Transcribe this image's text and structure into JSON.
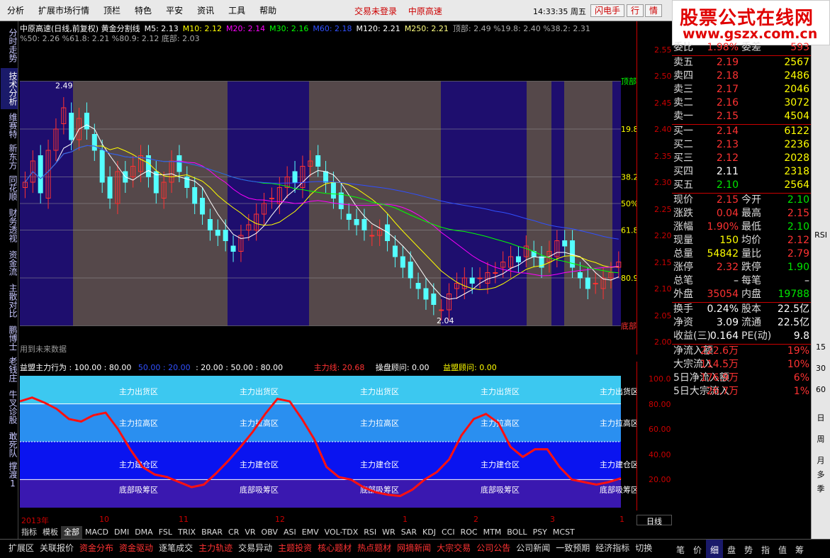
{
  "menu": {
    "items": [
      "分析",
      "扩展市场行情",
      "顶栏",
      "特色",
      "平安",
      "资讯",
      "工具",
      "帮助"
    ],
    "status1": "交易未登录",
    "status2": "中原高速",
    "time": "14:33:35 周五",
    "btn_flash": "闪电手",
    "btn_row": "行",
    "btn_quote": "情"
  },
  "logo": {
    "line1": "股票公式在线网",
    "line2": "www.gszx.com.cn"
  },
  "left_tabs": [
    "分时走势",
    "技术分析",
    "维赛特",
    "新东方",
    "同花顺",
    "财务透视",
    "资金流",
    "主散对比",
    "鹏博士",
    "老钱庄",
    "牛叉诊股",
    "敢死队",
    "撑渡1"
  ],
  "chart_header": {
    "line1": [
      {
        "t": "中原高速(日线,前复权) 黄金分割线",
        "c": "#ffffff"
      },
      {
        "t": "M5: 2.13",
        "c": "#ffffff"
      },
      {
        "t": "M10: 2.12",
        "c": "#ffff00"
      },
      {
        "t": "M20: 2.14",
        "c": "#ff00ff"
      },
      {
        "t": "M30: 2.16",
        "c": "#00ff00"
      },
      {
        "t": "M60: 2.18",
        "c": "#3050ff"
      },
      {
        "t": "M120: 2.21",
        "c": "#ffffff"
      },
      {
        "t": "M250: 2.21",
        "c": "#ffff80"
      },
      {
        "t": "顶部: 2.49 %19.8: 2.40 %38.2: 2.31",
        "c": "#aaaaaa"
      }
    ],
    "line2": "%50: 2.26 %61.8: 2.21 %80.9: 2.12 底部: 2.03"
  },
  "chart_labels": {
    "top": "2.49",
    "bottom": "2.04",
    "future": "用到未来数据",
    "level_top": "顶部",
    "l198": "19.8",
    "l382": "38.2",
    "l50": "50%",
    "l618": "61.8",
    "l809": "80.9",
    "level_bottom": "底部"
  },
  "price_axis": [
    "2.55",
    "2.50",
    "2.45",
    "2.40",
    "2.35",
    "2.30",
    "2.25",
    "2.20",
    "2.15",
    "2.10",
    "2.05",
    "2.00"
  ],
  "indicator": {
    "title": "益盟主力行为 : 100.00 : 80.00",
    "mid": "50.00 : 20.00",
    "tail": ": 20.00 : 50.00 : 80.00",
    "zhuli": "主力线: 20.68",
    "caopan": "操盘顾问: 0.00",
    "yimeng": "益盟顾问: 0.00",
    "zones": [
      "主力出货区",
      "主力拉高区",
      "主力建仓区",
      "底部吸筹区"
    ],
    "axis": [
      "100.0",
      "80.00",
      "60.00",
      "40.00",
      "20.00"
    ]
  },
  "time_axis": [
    "2013年",
    "10",
    "11",
    "12",
    "1",
    "2",
    "3",
    "1"
  ],
  "period_label": "日线",
  "quote": {
    "rows": [
      {
        "k": "委比",
        "v": "1.98%",
        "vc": "red",
        "k2": "委差",
        "v2": "593",
        "v2c": "red"
      },
      {
        "k": "卖五",
        "v": "2.19",
        "vc": "red",
        "v2": "2567",
        "v2c": "yellow"
      },
      {
        "k": "卖四",
        "v": "2.18",
        "vc": "red",
        "v2": "2486",
        "v2c": "yellow"
      },
      {
        "k": "卖三",
        "v": "2.17",
        "vc": "red",
        "v2": "2046",
        "v2c": "yellow"
      },
      {
        "k": "卖二",
        "v": "2.16",
        "vc": "red",
        "v2": "3072",
        "v2c": "yellow"
      },
      {
        "k": "卖一",
        "v": "2.15",
        "vc": "red",
        "v2": "4504",
        "v2c": "yellow"
      },
      {
        "k": "买一",
        "v": "2.14",
        "vc": "red",
        "v2": "6122",
        "v2c": "yellow"
      },
      {
        "k": "买二",
        "v": "2.13",
        "vc": "red",
        "v2": "2236",
        "v2c": "yellow"
      },
      {
        "k": "买三",
        "v": "2.12",
        "vc": "red",
        "v2": "2028",
        "v2c": "yellow"
      },
      {
        "k": "买四",
        "v": "2.11",
        "vc": "white",
        "v2": "2318",
        "v2c": "yellow"
      },
      {
        "k": "买五",
        "v": "2.10",
        "vc": "green",
        "v2": "2564",
        "v2c": "yellow"
      },
      {
        "k": "现价",
        "v": "2.15",
        "vc": "red",
        "k2": "今开",
        "v2": "2.10",
        "v2c": "green"
      },
      {
        "k": "涨跌",
        "v": "0.04",
        "vc": "red",
        "k2": "最高",
        "v2": "2.15",
        "v2c": "red"
      },
      {
        "k": "涨幅",
        "v": "1.90%",
        "vc": "red",
        "k2": "最低",
        "v2": "2.10",
        "v2c": "green"
      },
      {
        "k": "现量",
        "v": "150",
        "vc": "yellow",
        "k2": "均价",
        "v2": "2.12",
        "v2c": "red"
      },
      {
        "k": "总量",
        "v": "54842",
        "vc": "yellow",
        "k2": "量比",
        "v2": "2.79",
        "v2c": "red"
      },
      {
        "k": "涨停",
        "v": "2.32",
        "vc": "red",
        "k2": "跌停",
        "v2": "1.90",
        "v2c": "green"
      },
      {
        "k": "总笔",
        "v": "–",
        "vc": "white",
        "k2": "每笔",
        "v2": "–",
        "v2c": "white"
      },
      {
        "k": "外盘",
        "v": "35054",
        "vc": "red",
        "k2": "内盘",
        "v2": "19788",
        "v2c": "green"
      },
      {
        "k": "换手",
        "v": "0.24%",
        "vc": "white",
        "k2": "股本",
        "v2": "22.5亿",
        "v2c": "white"
      },
      {
        "k": "净资",
        "v": "3.09",
        "vc": "white",
        "k2": "流通",
        "v2": "22.5亿",
        "v2c": "white"
      },
      {
        "k": "收益(三)",
        "v": "0.164",
        "vc": "white",
        "k2": "PE(动)",
        "v2": "9.8",
        "v2c": "white"
      },
      {
        "k": "净流入额",
        "v": "222.6万",
        "vc": "red",
        "v2": "19%",
        "v2c": "red"
      },
      {
        "k": "大宗流入",
        "v": "114.5万",
        "vc": "red",
        "v2": "10%",
        "v2c": "red"
      },
      {
        "k": "5日净流入额",
        "v": "176.9万",
        "vc": "red",
        "v2": "6%",
        "v2c": "red"
      },
      {
        "k": "5日大宗流入",
        "v": "26.7万",
        "vc": "red",
        "v2": "1%",
        "v2c": "red"
      }
    ]
  },
  "right_tabs": [
    "RSI",
    "15",
    "30",
    "60",
    "日",
    "周",
    "月",
    "多",
    "季"
  ],
  "indicator_tabs": [
    "指标",
    "模板",
    "全部",
    "MACD",
    "DMI",
    "DMA",
    "FSL",
    "TRIX",
    "BRAR",
    "CR",
    "VR",
    "OBV",
    "ASI",
    "EMV",
    "VOL-TDX",
    "RSI",
    "WR",
    "SAR",
    "KDJ",
    "CCI",
    "ROC",
    "MTM",
    "BOLL",
    "PSY",
    "MCST"
  ],
  "status_tabs": [
    "扩展区",
    "关联报价",
    "资金分布",
    "资金驱动",
    "逐笔成交",
    "主力轨迹",
    "交易异动",
    "主题投资",
    "核心题材",
    "热点题材",
    "网摘新闻",
    "大宗交易",
    "公司公告",
    "公司新闻",
    "一致预期",
    "经济指标",
    "切换"
  ],
  "right_bottom_tabs": [
    "笔",
    "价",
    "细",
    "盘",
    "势",
    "指",
    "值",
    "筹"
  ],
  "chart_data": {
    "type": "candlestick",
    "title": "中原高速(日线,前复权) 黄金分割线",
    "ylim": [
      2.0,
      2.56
    ],
    "fib_levels": {
      "top": 2.49,
      "19.8": 2.4,
      "38.2": 2.31,
      "50": 2.26,
      "61.8": 2.21,
      "80.9": 2.12,
      "bottom": 2.03
    },
    "closes": [
      2.3,
      2.34,
      2.28,
      2.36,
      2.4,
      2.44,
      2.38,
      2.42,
      2.4,
      2.36,
      2.3,
      2.27,
      2.32,
      2.3,
      2.33,
      2.35,
      2.31,
      2.28,
      2.3,
      2.34,
      2.32,
      2.29,
      2.26,
      2.24,
      2.21,
      2.2,
      2.19,
      2.17,
      2.2,
      2.22,
      2.24,
      2.26,
      2.27,
      2.29,
      2.31,
      2.3,
      2.33,
      2.34,
      2.33,
      2.3,
      2.27,
      2.25,
      2.23,
      2.22,
      2.21,
      2.2,
      2.21,
      2.19,
      2.16,
      2.14,
      2.12,
      2.1,
      2.08,
      2.07,
      2.06,
      2.09,
      2.11,
      2.12,
      2.11,
      2.12,
      2.13,
      2.13,
      2.15,
      2.16,
      2.15,
      2.18,
      2.16,
      2.14,
      2.17,
      2.19,
      2.18,
      2.14,
      2.12,
      2.1,
      2.11,
      2.12,
      2.13,
      2.15
    ]
  },
  "indicator_data": {
    "values": [
      82,
      85,
      81,
      76,
      68,
      66,
      71,
      73,
      60,
      44,
      30,
      24,
      22,
      18,
      14,
      16,
      25,
      35,
      46,
      58,
      72,
      84,
      82,
      68,
      52,
      30,
      22,
      20,
      14,
      10,
      8,
      7,
      12,
      20,
      26,
      36,
      55,
      68,
      72,
      65,
      46,
      38,
      44,
      44,
      30,
      20,
      18,
      16,
      18,
      21
    ]
  }
}
